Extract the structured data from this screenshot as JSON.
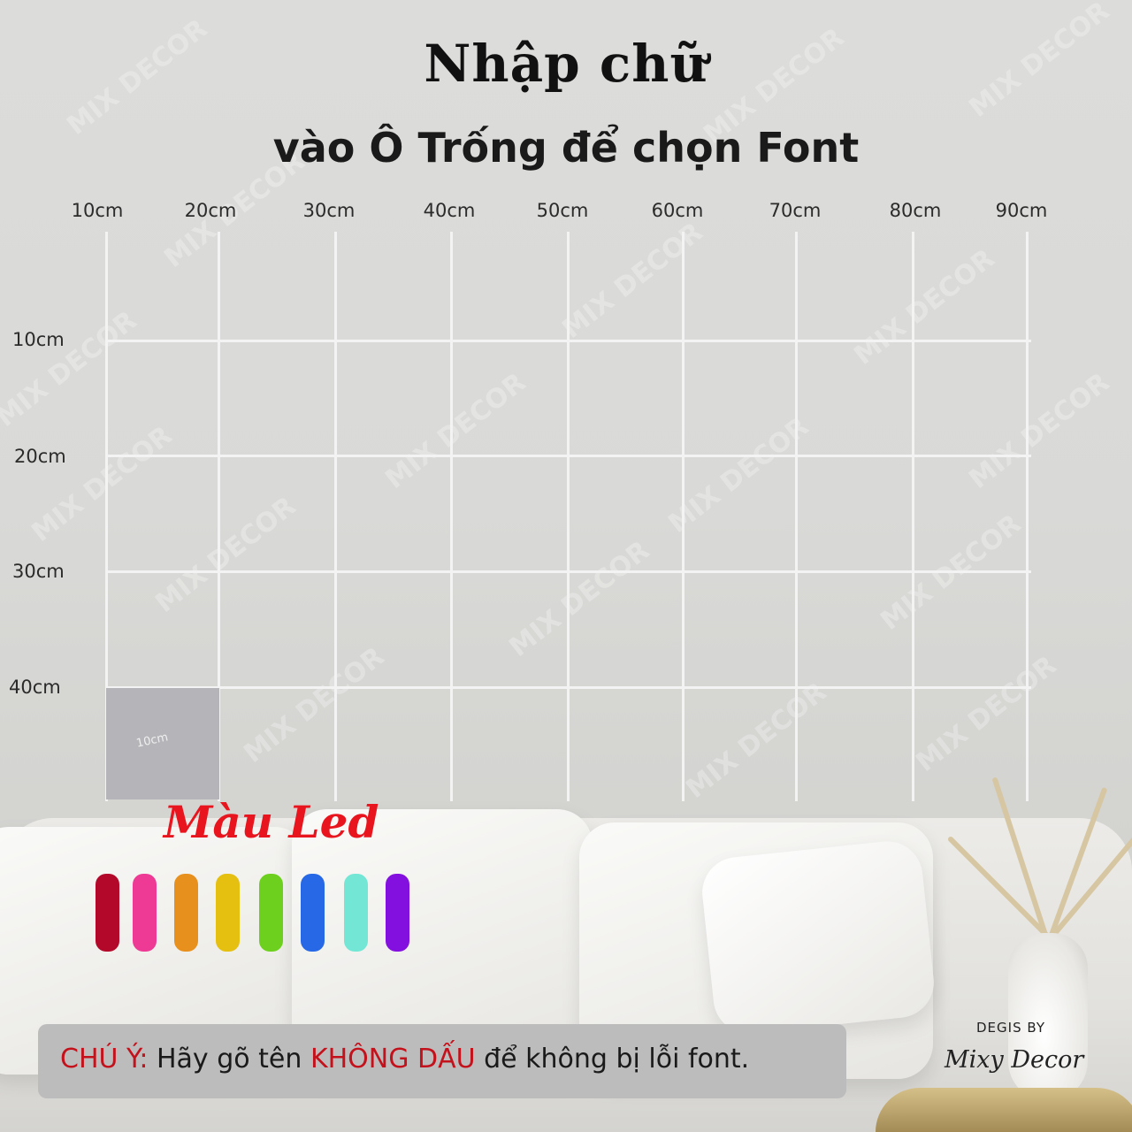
{
  "title": "Nhập chữ",
  "subtitle": "vào Ô Trống để chọn Font",
  "grid": {
    "columns": [
      "10cm",
      "20cm",
      "30cm",
      "40cm",
      "50cm",
      "60cm",
      "70cm",
      "80cm",
      "90cm"
    ],
    "rows": [
      "10cm",
      "20cm",
      "30cm",
      "40cm"
    ],
    "sample_square_label": "10cm"
  },
  "watermark_text": "MIX DECOR",
  "led": {
    "label": "Màu Led",
    "colors": [
      "#b4082a",
      "#ee3a94",
      "#e8901e",
      "#e6c010",
      "#6ed01e",
      "#2668e6",
      "#74e6d6",
      "#8410e0"
    ]
  },
  "notice": {
    "prefix": "CHÚ Ý:",
    "part1": " Hãy gõ tên ",
    "emphasis": "KHÔNG DẤU",
    "part2": " để không bị lỗi font."
  },
  "credit": {
    "by": "DEGIS BY",
    "name": "Mixy Decor"
  }
}
